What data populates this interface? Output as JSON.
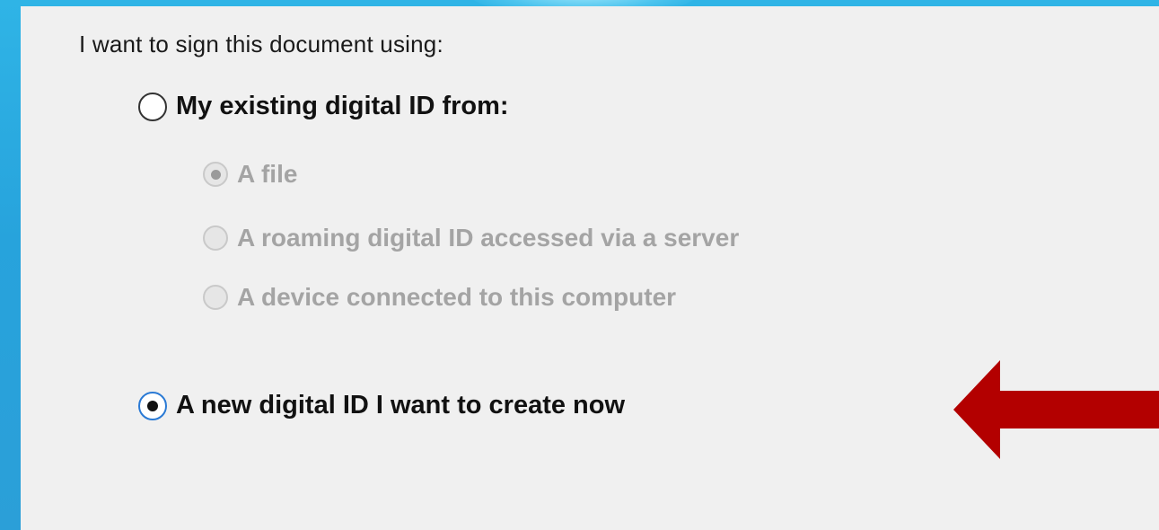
{
  "dialog": {
    "prompt": "I want to sign this document using:",
    "existing_id": {
      "label": "My existing digital ID from:",
      "selected": false,
      "sub_options": [
        {
          "label": "A file",
          "selected": true,
          "enabled": false
        },
        {
          "label": "A roaming digital ID accessed via a server",
          "selected": false,
          "enabled": false
        },
        {
          "label": "A device connected to this computer",
          "selected": false,
          "enabled": false
        }
      ]
    },
    "new_id": {
      "label": "A new digital ID I want to create now",
      "selected": true
    }
  },
  "annotation": {
    "arrow_color": "#b30000",
    "arrow_direction": "left"
  },
  "colors": {
    "background_blue": "#2ba8e0",
    "panel": "#f0f0f0",
    "disabled_text": "#a4a4a4",
    "selected_ring": "#2a7ad5"
  }
}
